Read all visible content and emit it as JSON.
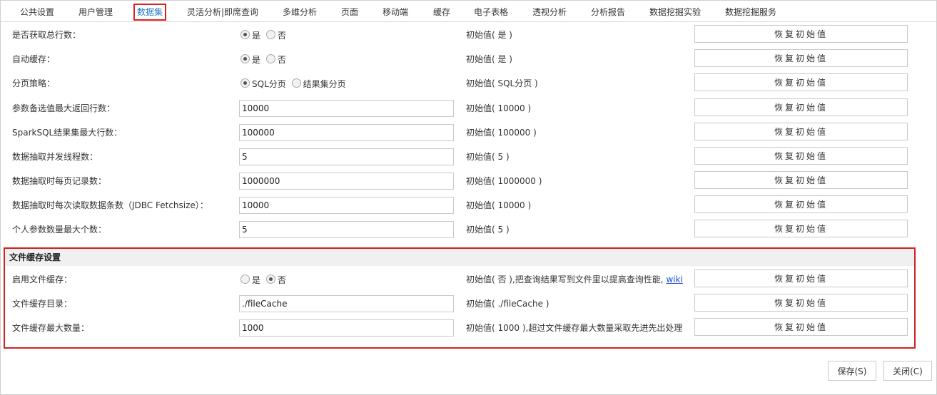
{
  "tabs": [
    {
      "label": "公共设置"
    },
    {
      "label": "用户管理"
    },
    {
      "label": "数据集"
    },
    {
      "label": "灵活分析|即席查询"
    },
    {
      "label": "多维分析"
    },
    {
      "label": "页面"
    },
    {
      "label": "移动端"
    },
    {
      "label": "缓存"
    },
    {
      "label": "电子表格"
    },
    {
      "label": "透视分析"
    },
    {
      "label": "分析报告"
    },
    {
      "label": "数据挖掘实验"
    },
    {
      "label": "数据挖掘服务"
    }
  ],
  "active_tab": "数据集",
  "restore_label": "恢复初始值",
  "settings": {
    "total_rows": {
      "label": "是否获取总行数：",
      "opt_yes": "是",
      "opt_no": "否",
      "selected": "是",
      "initial": "初始值( 是 )"
    },
    "auto_cache": {
      "label": "自动缓存：",
      "opt_yes": "是",
      "opt_no": "否",
      "selected": "是",
      "initial": "初始值( 是 )"
    },
    "paging": {
      "label": "分页策略：",
      "opt_a": "SQL分页",
      "opt_b": "结果集分页",
      "selected": "SQL分页",
      "initial": "初始值( SQL分页 )"
    },
    "param_max_rows": {
      "label": "参数备选值最大返回行数：",
      "value": "10000",
      "initial": "初始值( 10000 )"
    },
    "sparksql_max_rows": {
      "label": "SparkSQL结果集最大行数：",
      "value": "100000",
      "initial": "初始值( 100000 )"
    },
    "extract_threads": {
      "label": "数据抽取并发线程数：",
      "value": "5",
      "initial": "初始值( 5 )"
    },
    "extract_page_records": {
      "label": "数据抽取时每页记录数：",
      "value": "1000000",
      "initial": "初始值( 1000000 )"
    },
    "fetchsize": {
      "label": "数据抽取时每次读取数据条数（JDBC Fetchsize）：",
      "value": "10000",
      "initial": "初始值( 10000 )"
    },
    "personal_params_max": {
      "label": "个人参数数量最大个数：",
      "value": "5",
      "initial": "初始值( 5 )"
    }
  },
  "file_cache": {
    "title": "文件缓存设置",
    "enable": {
      "label": "启用文件缓存：",
      "opt_yes": "是",
      "opt_no": "否",
      "selected": "否",
      "initial": "初始值( 否 ),把查询结果写到文件里以提高查询性能,",
      "link": "wiki"
    },
    "dir": {
      "label": "文件缓存目录：",
      "value": "./fileCache",
      "initial": "初始值( ./fileCache )"
    },
    "max_count": {
      "label": "文件缓存最大数量：",
      "value": "1000",
      "initial": "初始值( 1000 ),超过文件缓存最大数量采取先进先出处理"
    }
  },
  "footer": {
    "save": "保存(S)",
    "close": "关闭(C)"
  },
  "colors": {
    "active_tab_text": "#2b7ac4",
    "highlight_border": "#d42020",
    "link": "#1a4fd6"
  }
}
